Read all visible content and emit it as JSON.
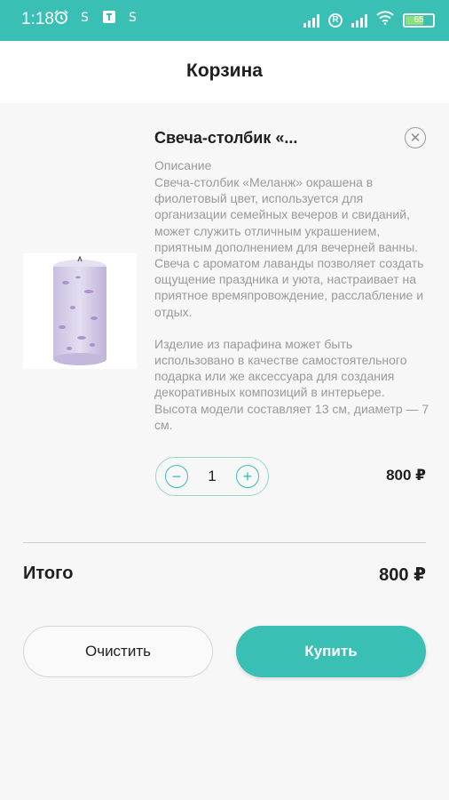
{
  "status_bar": {
    "time": "1:18",
    "battery_level": "65",
    "network_label": "R"
  },
  "header": {
    "title": "Корзина"
  },
  "cart_item": {
    "name": "Свеча-столбик «...",
    "description_label": "Описание",
    "description_paragraphs": [
      "Свеча-столбик «Меланж» окрашена в фиолетовый цвет, используется для организации семейных вечеров и свиданий, может служить отличным украшением, приятным дополнением для вечерней ванны. Свеча с ароматом лаванды позволяет создать ощущение праздника и уюта, настраивает на приятное времяпровождение, расслабление и отдых.",
      "Изделие из парафина может быть использовано в качестве самостоятельного подарка или же аксессуара для создания декоративных композиций в интерьере. Высота модели составляет 13 см, диаметр — 7 см."
    ],
    "quantity": "1",
    "price": "800 ₽",
    "image_icon": "lavender-candle-image"
  },
  "summary": {
    "total_label": "Итого",
    "total_value": "800 ₽"
  },
  "actions": {
    "clear_label": "Очистить",
    "buy_label": "Купить"
  },
  "colors": {
    "accent": "#39bfb4",
    "background": "#f7f7f7",
    "muted_text": "#9a9a9a"
  }
}
